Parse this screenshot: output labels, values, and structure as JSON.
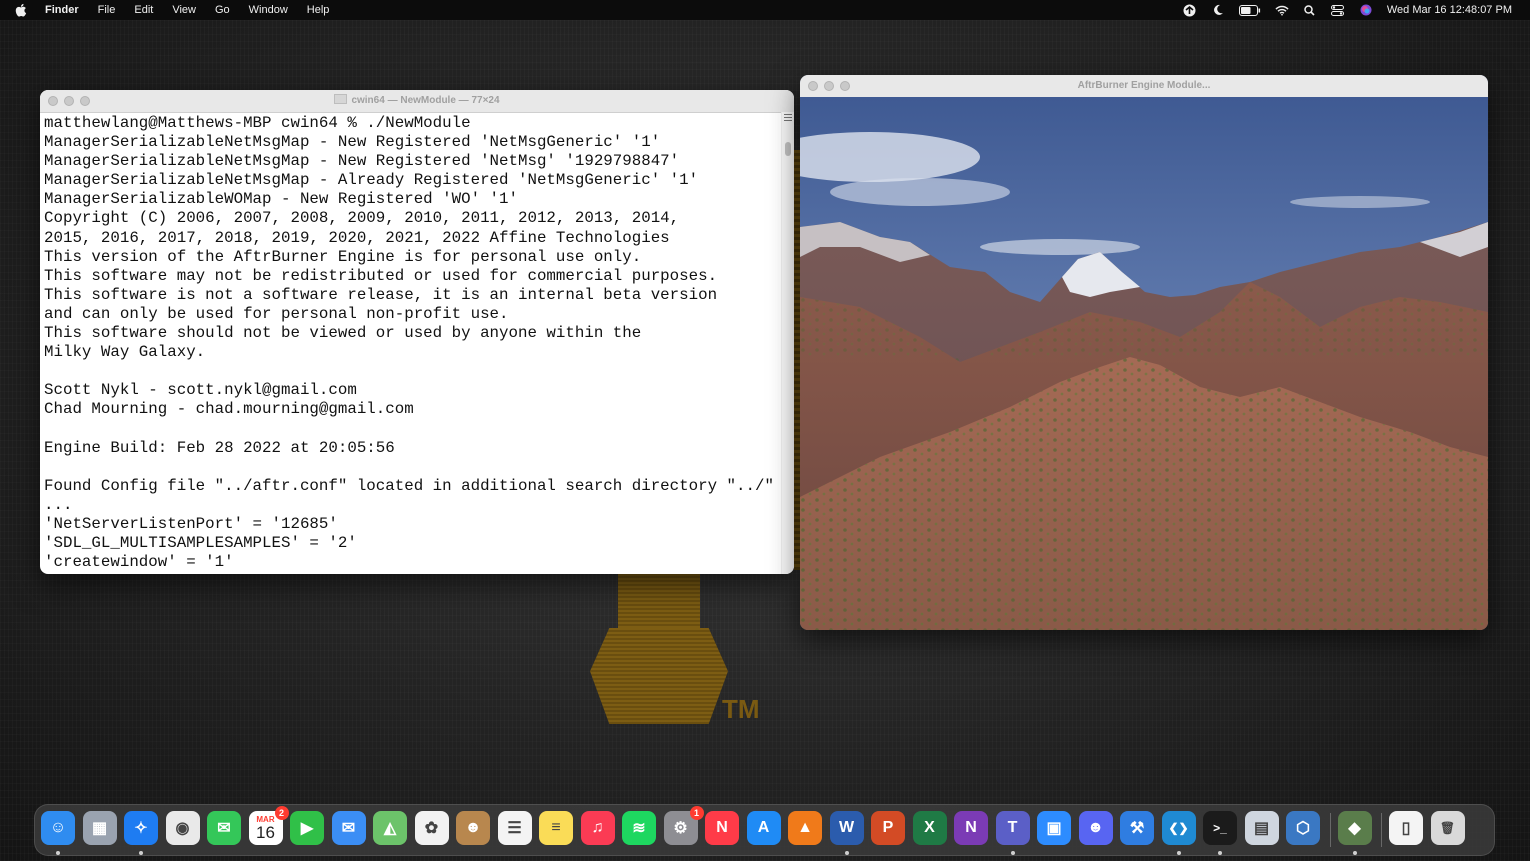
{
  "menubar": {
    "app_name": "Finder",
    "menus": [
      "File",
      "Edit",
      "View",
      "Go",
      "Window",
      "Help"
    ],
    "battery_label": "52",
    "clock": "Wed Mar 16  12:48:07 PM"
  },
  "terminal": {
    "title": "cwin64 — NewModule — 77×24",
    "lines": [
      "matthewlang@Matthews-MBP cwin64 % ./NewModule",
      "ManagerSerializableNetMsgMap - New Registered 'NetMsgGeneric' '1'",
      "ManagerSerializableNetMsgMap - New Registered 'NetMsg' '1929798847'",
      "ManagerSerializableNetMsgMap - Already Registered 'NetMsgGeneric' '1'",
      "ManagerSerializableWOMap - New Registered 'WO' '1'",
      "Copyright (C) 2006, 2007, 2008, 2009, 2010, 2011, 2012, 2013, 2014,",
      "2015, 2016, 2017, 2018, 2019, 2020, 2021, 2022 Affine Technologies",
      "This version of the AftrBurner Engine is for personal use only.",
      "This software may not be redistributed or used for commercial purposes.",
      "This software is not a software release, it is an internal beta version",
      "and can only be used for personal non-profit use.",
      "This software should not be viewed or used by anyone within the",
      "Milky Way Galaxy.",
      "",
      "Scott Nykl - scott.nykl@gmail.com",
      "Chad Mourning - chad.mourning@gmail.com",
      "",
      "Engine Build: Feb 28 2022 at 20:05:56",
      "",
      "Found Config file \"../aftr.conf\" located in additional search directory \"../\"",
      "...",
      "'NetServerListenPort' = '12685'",
      "'SDL_GL_MULTISAMPLESAMPLES' = '2'",
      "'createwindow' = '1'"
    ]
  },
  "engine_window": {
    "title": "AftrBurner Engine Module..."
  },
  "wallpaper": {
    "tm_mark": "TM"
  },
  "dock": {
    "calendar": {
      "month": "MAR",
      "day": "16",
      "badge": "2"
    },
    "settings_badge": "1",
    "items": [
      {
        "name": "finder",
        "color": "#2f8cf0",
        "glyph": "☺",
        "running": true
      },
      {
        "name": "launchpad",
        "color": "#9aa3b0",
        "glyph": "▦",
        "running": false
      },
      {
        "name": "safari",
        "color": "#1e7cf2",
        "glyph": "✧",
        "running": true
      },
      {
        "name": "chrome",
        "color": "#e9e9e9",
        "glyph": "◉",
        "running": false
      },
      {
        "name": "messages",
        "color": "#34c759",
        "glyph": "✉",
        "running": false
      },
      {
        "name": "calendar",
        "color": "#ffffff",
        "glyph": "",
        "running": false
      },
      {
        "name": "facetime",
        "color": "#30c048",
        "glyph": "▶",
        "running": false
      },
      {
        "name": "mail",
        "color": "#3b8ef5",
        "glyph": "✉",
        "running": false
      },
      {
        "name": "maps",
        "color": "#6cc36a",
        "glyph": "◭",
        "running": false
      },
      {
        "name": "photos",
        "color": "#f2f2f2",
        "glyph": "✿",
        "running": false
      },
      {
        "name": "contacts",
        "color": "#b8874e",
        "glyph": "☻",
        "running": false
      },
      {
        "name": "reminders",
        "color": "#f4f4f4",
        "glyph": "☰",
        "running": false
      },
      {
        "name": "notes",
        "color": "#fadc57",
        "glyph": "≡",
        "running": false
      },
      {
        "name": "music",
        "color": "#fb3b54",
        "glyph": "♫",
        "running": false
      },
      {
        "name": "spotify",
        "color": "#1ed760",
        "glyph": "≋",
        "running": false
      },
      {
        "name": "system-preferences",
        "color": "#8e8e93",
        "glyph": "⚙",
        "running": false
      },
      {
        "name": "news",
        "color": "#ff3b48",
        "glyph": "N",
        "running": false
      },
      {
        "name": "app-store",
        "color": "#1f8bf5",
        "glyph": "A",
        "running": false
      },
      {
        "name": "aftrburner",
        "color": "#f07a1a",
        "glyph": "▲",
        "running": false
      },
      {
        "name": "word",
        "color": "#2b5cad",
        "glyph": "W",
        "running": true
      },
      {
        "name": "powerpoint",
        "color": "#d34b25",
        "glyph": "P",
        "running": false
      },
      {
        "name": "excel",
        "color": "#1f7a45",
        "glyph": "X",
        "running": false
      },
      {
        "name": "onenote",
        "color": "#7b3bb5",
        "glyph": "N",
        "running": false
      },
      {
        "name": "teams",
        "color": "#5b5fc7",
        "glyph": "T",
        "running": true
      },
      {
        "name": "zoom",
        "color": "#2d8cff",
        "glyph": "▣",
        "running": false
      },
      {
        "name": "discord",
        "color": "#5865f2",
        "glyph": "☻",
        "running": false
      },
      {
        "name": "xcode",
        "color": "#2f7de1",
        "glyph": "⚒",
        "running": false
      },
      {
        "name": "vscode",
        "color": "#1f8ad2",
        "glyph": "❮❯",
        "running": true
      },
      {
        "name": "terminal",
        "color": "#1b1b1b",
        "glyph": ">_",
        "running": true
      },
      {
        "name": "preview",
        "color": "#cfd6df",
        "glyph": "▤",
        "running": false
      },
      {
        "name": "virtualbox",
        "color": "#3a78c3",
        "glyph": "⬡",
        "running": false
      },
      {
        "name": "engine-module",
        "color": "#5a7d4b",
        "glyph": "◆",
        "running": true
      },
      {
        "name": "documents",
        "color": "#f4f4f4",
        "glyph": "▯",
        "running": false
      },
      {
        "name": "trash",
        "color": "#d9d9d9",
        "glyph": "🗑",
        "running": false
      }
    ]
  }
}
